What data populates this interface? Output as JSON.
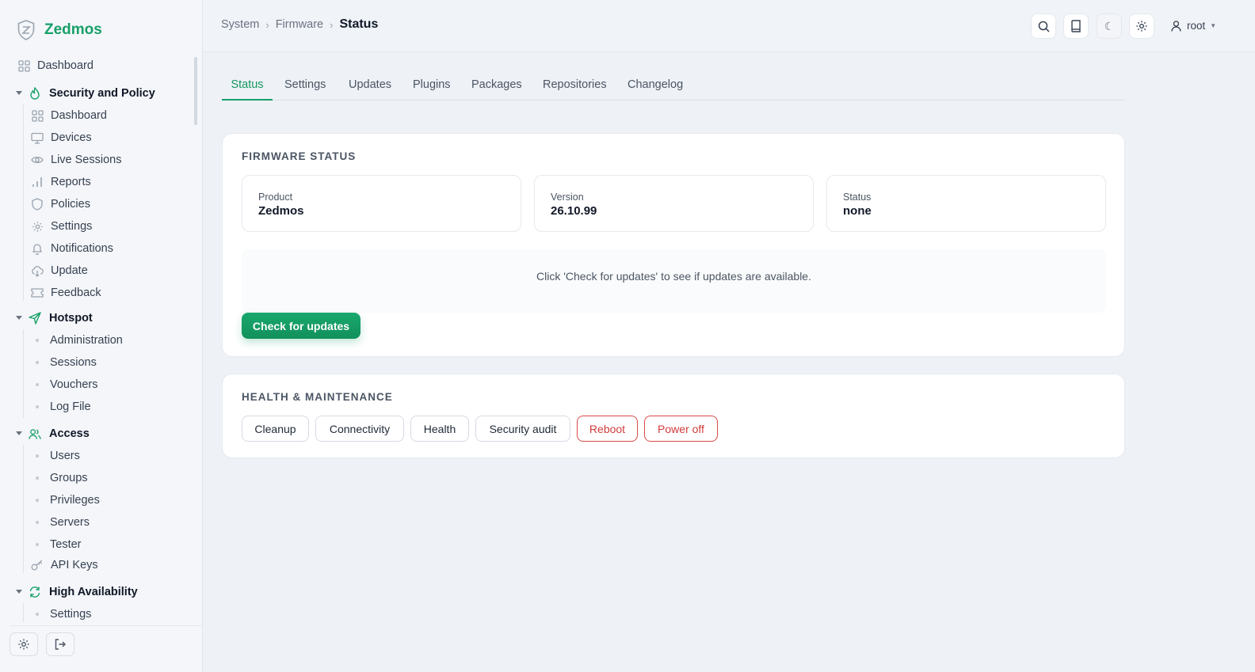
{
  "app": {
    "name": "Zedmos"
  },
  "colors": {
    "accent": "#18a06a",
    "danger": "#d23c3c",
    "background": "#eef1f6"
  },
  "sidebar": {
    "top": {
      "label": "Dashboard",
      "icon": "grid-icon"
    },
    "security": {
      "label": "Security and Policy",
      "icon": "flame-icon",
      "items": [
        {
          "label": "Dashboard",
          "icon": "grid-icon"
        },
        {
          "label": "Devices",
          "icon": "monitor-icon"
        },
        {
          "label": "Live Sessions",
          "icon": "eye-icon"
        },
        {
          "label": "Reports",
          "icon": "bar-chart-icon"
        },
        {
          "label": "Policies",
          "icon": "shield-icon"
        },
        {
          "label": "Settings",
          "icon": "gear-icon"
        },
        {
          "label": "Notifications",
          "icon": "bell-icon"
        },
        {
          "label": "Update",
          "icon": "cloud-download-icon"
        },
        {
          "label": "Feedback",
          "icon": "ticket-icon"
        }
      ]
    },
    "hotspot": {
      "label": "Hotspot",
      "icon": "send-icon",
      "items": [
        {
          "label": "Administration"
        },
        {
          "label": "Sessions"
        },
        {
          "label": "Vouchers"
        },
        {
          "label": "Log File"
        }
      ]
    },
    "access": {
      "label": "Access",
      "icon": "users-icon",
      "items": [
        {
          "label": "Users"
        },
        {
          "label": "Groups"
        },
        {
          "label": "Privileges"
        },
        {
          "label": "Servers"
        },
        {
          "label": "Tester"
        },
        {
          "label": "API Keys",
          "icon": "key-icon"
        }
      ]
    },
    "ha": {
      "label": "High Availability",
      "icon": "refresh-icon",
      "items": [
        {
          "label": "Settings"
        }
      ]
    }
  },
  "header": {
    "breadcrumb": [
      "System",
      "Firmware",
      "Status"
    ],
    "user": "root"
  },
  "tabs": [
    "Status",
    "Settings",
    "Updates",
    "Plugins",
    "Packages",
    "Repositories",
    "Changelog"
  ],
  "firmware": {
    "title": "FIRMWARE STATUS",
    "stats": [
      {
        "label": "Product",
        "value": "Zedmos"
      },
      {
        "label": "Version",
        "value": "26.10.99"
      },
      {
        "label": "Status",
        "value": "none"
      }
    ],
    "notice": "Click 'Check for updates' to see if updates are available.",
    "check_button": "Check for updates"
  },
  "health": {
    "title": "HEALTH & MAINTENANCE",
    "buttons": [
      "Cleanup",
      "Connectivity",
      "Health",
      "Security audit",
      "Reboot",
      "Power off"
    ]
  }
}
